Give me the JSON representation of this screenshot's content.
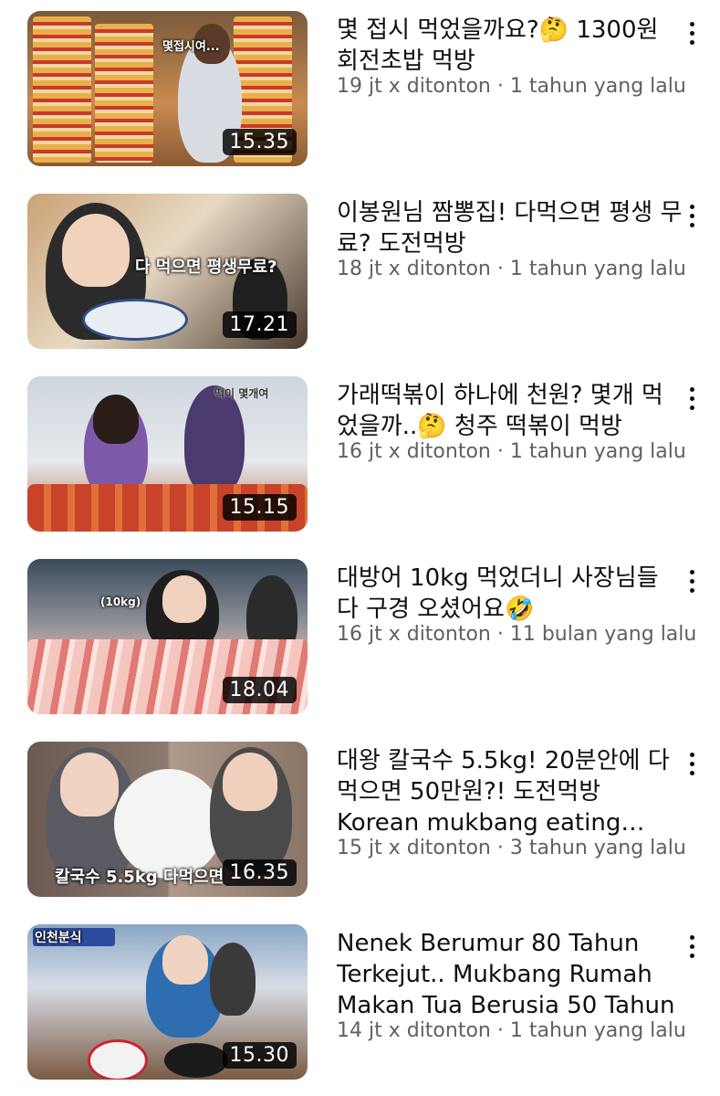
{
  "videos": [
    {
      "title": "몇 접시 먹었을까요?🤔 1300원 회전초밥 먹방",
      "views": "19 jt x ditonton",
      "sep": " · ",
      "age": "1 tahun yang lalu",
      "duration": "15.35",
      "thumb_caption": "몇접시여..."
    },
    {
      "title": "이봉원님 짬뽕집! 다먹으면 평생 무료? 도전먹방",
      "views": "18 jt x ditonton",
      "sep": " · ",
      "age": "1 tahun yang lalu",
      "duration": "17.21",
      "thumb_caption": "다 먹으면 평생무료?"
    },
    {
      "title": "가래떡볶이 하나에 천원? 몇개 먹었을까..🤔 청주 떡볶이 먹방",
      "views": "16 jt x ditonton",
      "sep": " · ",
      "age": "1 tahun yang lalu",
      "duration": "15.15",
      "thumb_caption": "떡이 몇개여"
    },
    {
      "title": "대방어 10kg 먹었더니 사장님들 다 구경 오셨어요🤣",
      "views": "16 jt x ditonton",
      "sep": " · ",
      "age": "11 bulan yang lalu",
      "duration": "18.04",
      "thumb_caption": "(10kg)"
    },
    {
      "title": "대왕 칼국수 5.5kg! 20분안에 다먹으면 50만원?! 도전먹방 Korean mukbang eating show",
      "views": "15 jt x ditonton",
      "sep": " · ",
      "age": "3 tahun yang lalu",
      "duration": "16.35",
      "thumb_caption": "칼국수 5.5kg 다먹으면"
    },
    {
      "title": "Nenek Berumur 80 Tahun Terkejut.. Mukbang  Rumah Makan Tua Berusia 50 Tahun",
      "views": "14 jt x ditonton",
      "sep": " · ",
      "age": "1 tahun yang lalu",
      "duration": "15.30",
      "thumb_caption": "인천분식"
    }
  ],
  "icons": {
    "more": "more-vert-icon"
  }
}
